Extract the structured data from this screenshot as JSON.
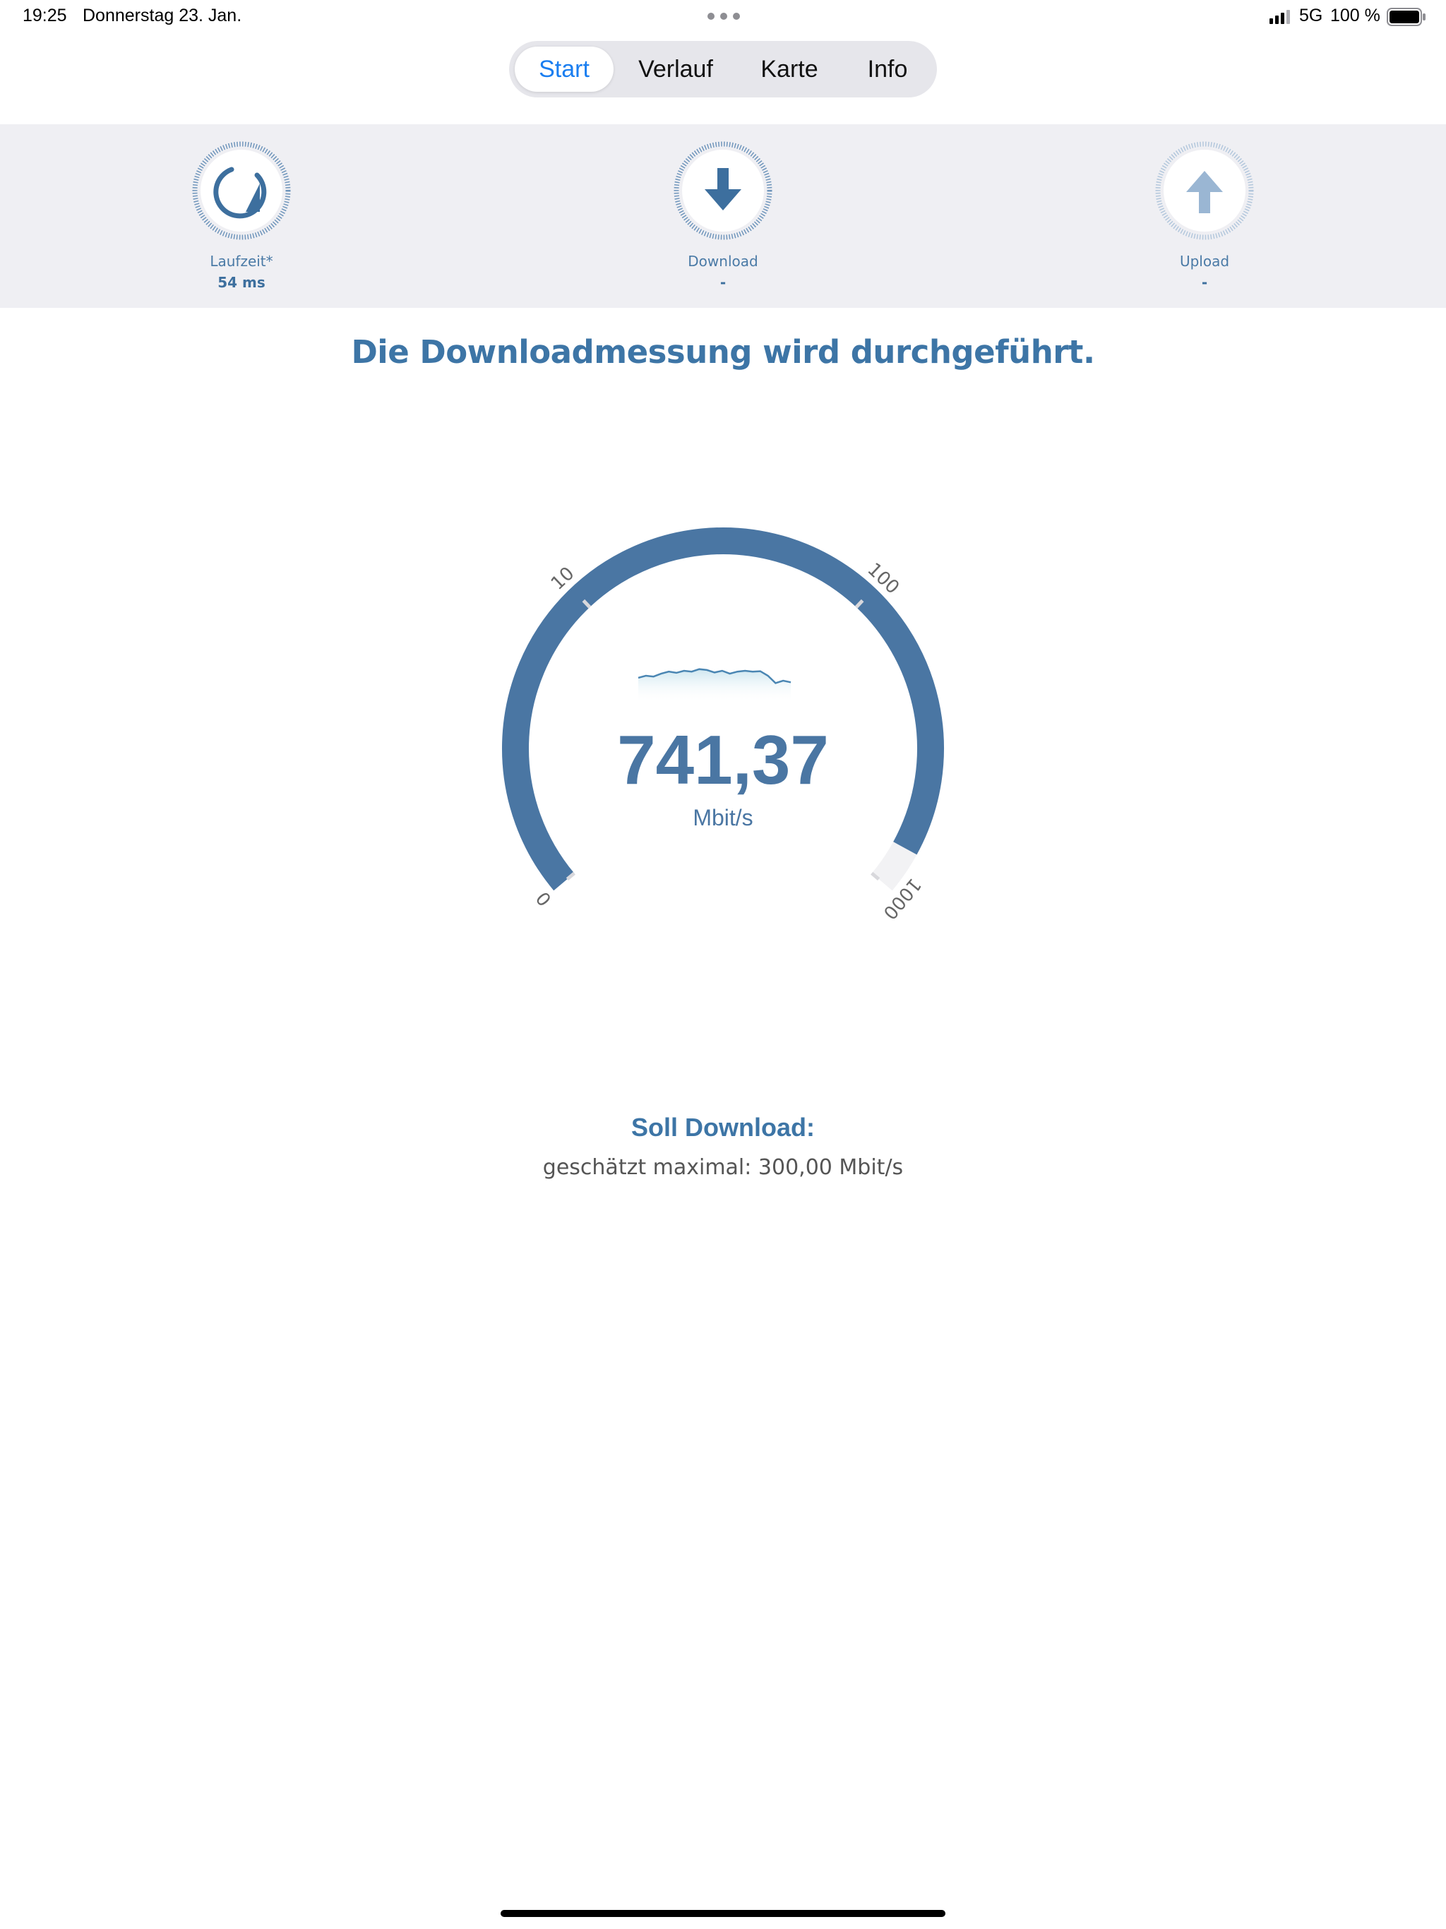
{
  "status_bar": {
    "time": "19:25",
    "date": "Donnerstag 23. Jan.",
    "network": "5G",
    "battery_percent": "100 %",
    "battery_level": 1.0
  },
  "tabs": [
    {
      "label": "Start",
      "active": true
    },
    {
      "label": "Verlauf",
      "active": false
    },
    {
      "label": "Karte",
      "active": false
    },
    {
      "label": "Info",
      "active": false
    }
  ],
  "metrics": {
    "latency": {
      "label": "Laufzeit*",
      "value": "54 ms",
      "icon": "refresh-icon"
    },
    "download": {
      "label": "Download",
      "value": "-",
      "icon": "arrow-down-icon"
    },
    "upload": {
      "label": "Upload",
      "value": "-",
      "icon": "arrow-up-icon"
    }
  },
  "headline": "Die Downloadmessung wird durchgeführt.",
  "gauge": {
    "value": "741,37",
    "unit": "Mbit/s",
    "scale": "log",
    "ticks": [
      "0",
      "10",
      "100",
      "1000"
    ],
    "current_mbit": 741.37,
    "max_mbit": 1000,
    "sparkline": [
      0.45,
      0.5,
      0.48,
      0.55,
      0.6,
      0.57,
      0.62,
      0.6,
      0.66,
      0.64,
      0.58,
      0.62,
      0.55,
      0.6,
      0.62,
      0.6,
      0.61,
      0.5,
      0.32,
      0.38,
      0.34
    ]
  },
  "target": {
    "title": "Soll Download:",
    "text": "geschätzt maximal: 300,00 Mbit/s"
  },
  "colors": {
    "accent": "#4a76a3",
    "heading": "#3d75a6",
    "active_tab": "#1a7ef0",
    "band": "#efeff3"
  }
}
